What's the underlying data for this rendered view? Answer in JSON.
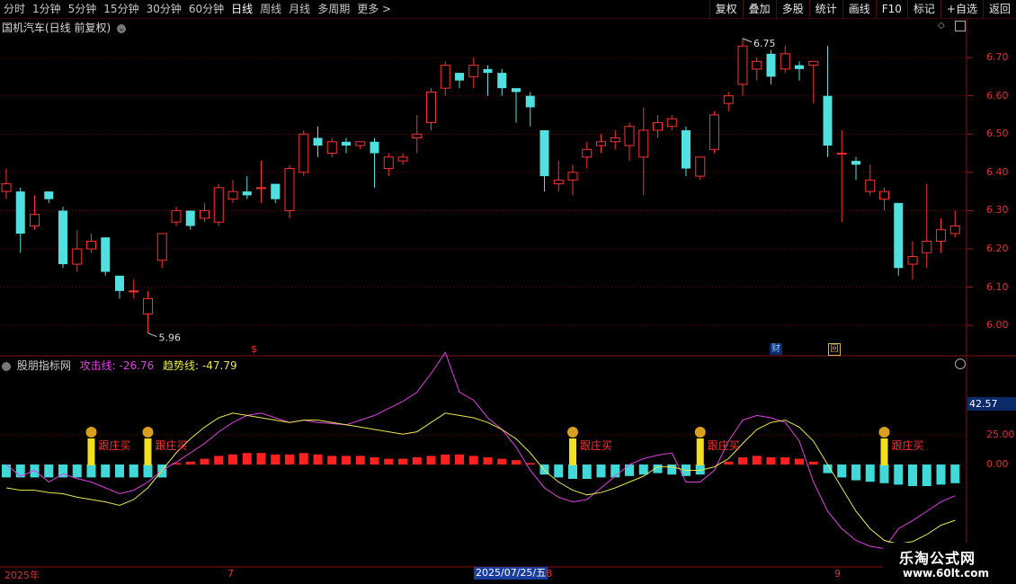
{
  "toolbar": {
    "periods": [
      "分时",
      "1分钟",
      "5分钟",
      "15分钟",
      "30分钟",
      "60分钟",
      "日线",
      "周线",
      "月线",
      "多周期",
      "更多 >"
    ],
    "active_period": "日线",
    "tools": [
      "复权",
      "叠加",
      "多股",
      "统计",
      "画线",
      "F10",
      "标记",
      "+自选",
      "返回"
    ]
  },
  "chart_title": "国机汽车(日线 前复权)",
  "price_axis": [
    "6.70",
    "6.60",
    "6.50",
    "6.40",
    "6.30",
    "6.20",
    "6.10",
    "6.00"
  ],
  "high_label": "6.75",
  "low_label": "5.96",
  "markers": {
    "dollar": "$",
    "finance": "财",
    "back": "回"
  },
  "indicator": {
    "name": "股朋指标网",
    "attack_label": "攻击线: -26.76",
    "trend_label": "趋势线: -47.79",
    "value_badge": "42.57",
    "axis": [
      "25.00",
      "0.00"
    ],
    "signal_text": "跟庄买",
    "colors": {
      "attack": "#e040e0",
      "trend": "#e8e84a",
      "up": "#ff2020",
      "down": "#40d8d8",
      "signal": "#f0e020"
    }
  },
  "dates": {
    "year": "2025年",
    "m7": "7",
    "current": "2025/07/25/五",
    "m8": "8",
    "m9": "9"
  },
  "logo": {
    "line1": "乐淘公式网",
    "line2": "www.60lt.com"
  },
  "chart_data": {
    "type": "candlestick",
    "ylim": [
      5.93,
      6.78
    ],
    "candles": [
      [
        6.35,
        6.37,
        6.33,
        6.41
      ],
      [
        6.35,
        6.24,
        6.19,
        6.36
      ],
      [
        6.26,
        6.29,
        6.25,
        6.34
      ],
      [
        6.35,
        6.33,
        6.32,
        6.35
      ],
      [
        6.3,
        6.16,
        6.15,
        6.31
      ],
      [
        6.16,
        6.2,
        6.14,
        6.25
      ],
      [
        6.2,
        6.22,
        6.19,
        6.24
      ],
      [
        6.23,
        6.14,
        6.13,
        6.23
      ],
      [
        6.13,
        6.09,
        6.07,
        6.13
      ],
      [
        6.09,
        6.09,
        6.07,
        6.12
      ],
      [
        6.03,
        6.07,
        5.98,
        6.09
      ],
      [
        6.17,
        6.24,
        6.15,
        6.24
      ],
      [
        6.27,
        6.3,
        6.26,
        6.31
      ],
      [
        6.3,
        6.26,
        6.25,
        6.3
      ],
      [
        6.28,
        6.3,
        6.27,
        6.32
      ],
      [
        6.27,
        6.36,
        6.26,
        6.37
      ],
      [
        6.33,
        6.35,
        6.32,
        6.38
      ],
      [
        6.35,
        6.34,
        6.33,
        6.39
      ],
      [
        6.36,
        6.36,
        6.32,
        6.43
      ],
      [
        6.37,
        6.33,
        6.32,
        6.37
      ],
      [
        6.3,
        6.41,
        6.28,
        6.42
      ],
      [
        6.4,
        6.5,
        6.39,
        6.51
      ],
      [
        6.49,
        6.47,
        6.44,
        6.52
      ],
      [
        6.45,
        6.48,
        6.44,
        6.49
      ],
      [
        6.48,
        6.47,
        6.45,
        6.49
      ],
      [
        6.47,
        6.48,
        6.46,
        6.48
      ],
      [
        6.48,
        6.45,
        6.36,
        6.49
      ],
      [
        6.41,
        6.44,
        6.39,
        6.45
      ],
      [
        6.43,
        6.44,
        6.42,
        6.45
      ],
      [
        6.49,
        6.5,
        6.45,
        6.55
      ],
      [
        6.53,
        6.61,
        6.51,
        6.62
      ],
      [
        6.62,
        6.68,
        6.6,
        6.69
      ],
      [
        6.66,
        6.64,
        6.62,
        6.66
      ],
      [
        6.65,
        6.68,
        6.62,
        6.7
      ],
      [
        6.67,
        6.66,
        6.6,
        6.68
      ],
      [
        6.66,
        6.62,
        6.6,
        6.67
      ],
      [
        6.62,
        6.61,
        6.53,
        6.62
      ],
      [
        6.6,
        6.57,
        6.52,
        6.61
      ],
      [
        6.51,
        6.39,
        6.35,
        6.51
      ],
      [
        6.37,
        6.38,
        6.35,
        6.43
      ],
      [
        6.38,
        6.4,
        6.34,
        6.42
      ],
      [
        6.44,
        6.46,
        6.41,
        6.48
      ],
      [
        6.47,
        6.48,
        6.45,
        6.5
      ],
      [
        6.48,
        6.49,
        6.46,
        6.51
      ],
      [
        6.47,
        6.52,
        6.43,
        6.53
      ],
      [
        6.44,
        6.51,
        6.34,
        6.57
      ],
      [
        6.51,
        6.53,
        6.49,
        6.55
      ],
      [
        6.52,
        6.54,
        6.51,
        6.55
      ],
      [
        6.51,
        6.41,
        6.39,
        6.52
      ],
      [
        6.39,
        6.44,
        6.38,
        6.44
      ],
      [
        6.46,
        6.55,
        6.45,
        6.56
      ],
      [
        6.58,
        6.6,
        6.56,
        6.61
      ],
      [
        6.63,
        6.73,
        6.6,
        6.75
      ],
      [
        6.67,
        6.69,
        6.64,
        6.7
      ],
      [
        6.71,
        6.65,
        6.63,
        6.72
      ],
      [
        6.67,
        6.71,
        6.66,
        6.73
      ],
      [
        6.68,
        6.67,
        6.64,
        6.69
      ],
      [
        6.68,
        6.69,
        6.58,
        6.69
      ],
      [
        6.6,
        6.47,
        6.44,
        6.73
      ],
      [
        6.45,
        6.45,
        6.27,
        6.51
      ],
      [
        6.43,
        6.42,
        6.38,
        6.44
      ],
      [
        6.35,
        6.38,
        6.34,
        6.42
      ],
      [
        6.33,
        6.35,
        6.3,
        6.36
      ],
      [
        6.32,
        6.15,
        6.13,
        6.32
      ],
      [
        6.16,
        6.18,
        6.12,
        6.22
      ],
      [
        6.19,
        6.22,
        6.15,
        6.37
      ],
      [
        6.22,
        6.25,
        6.19,
        6.28
      ],
      [
        6.24,
        6.26,
        6.23,
        6.3
      ]
    ],
    "volume_bars": [
      -2,
      -2,
      -2,
      -2,
      -2,
      -2,
      -2,
      -2,
      -2,
      -2,
      -2,
      -2,
      0.5,
      1,
      2,
      3,
      3.5,
      4,
      4,
      3.5,
      3.5,
      4,
      3.5,
      3,
      3,
      3,
      2.5,
      2,
      2,
      2.5,
      3,
      3.5,
      3.5,
      3,
      2.5,
      2,
      1.5,
      0.5,
      -1,
      -2,
      -2.5,
      -2.5,
      -2,
      -2,
      -1.5,
      -1,
      -0.5,
      -1,
      -1.5,
      -1,
      0,
      1,
      2.5,
      3,
      2.5,
      2.5,
      2,
      1,
      -0.5,
      -2,
      -3,
      -3.5,
      -4,
      -4.5,
      -5,
      -5,
      -4.5,
      -4
    ],
    "attack_line": [
      0,
      -10,
      -5,
      -15,
      -8,
      -12,
      -15,
      -20,
      -25,
      -22,
      -15,
      -5,
      2,
      10,
      18,
      28,
      36,
      42,
      44,
      40,
      36,
      38,
      36,
      35,
      34,
      38,
      42,
      48,
      54,
      62,
      78,
      96,
      62,
      55,
      40,
      30,
      15,
      -5,
      -20,
      -28,
      -32,
      -30,
      -20,
      -10,
      0,
      5,
      8,
      10,
      -15,
      -15,
      -5,
      20,
      38,
      42,
      40,
      36,
      20,
      -15,
      -40,
      -55,
      -65,
      -70,
      -72,
      -55,
      -48,
      -40,
      -32,
      -26.76
    ],
    "trend_line": [
      -20,
      -22,
      -22,
      -24,
      -25,
      -28,
      -30,
      -32,
      -35,
      -30,
      -20,
      -5,
      10,
      22,
      32,
      40,
      44,
      42,
      40,
      38,
      36,
      38,
      38,
      36,
      34,
      32,
      30,
      28,
      26,
      28,
      36,
      44,
      42,
      40,
      36,
      30,
      22,
      10,
      -5,
      -15,
      -22,
      -26,
      -24,
      -20,
      -15,
      -10,
      -2,
      -2,
      -5,
      -5,
      -2,
      5,
      18,
      30,
      36,
      38,
      32,
      20,
      0,
      -20,
      -40,
      -55,
      -65,
      -68,
      -66,
      -60,
      -52,
      -47.79
    ],
    "signal_index": [
      6,
      10,
      40,
      49,
      62
    ]
  }
}
